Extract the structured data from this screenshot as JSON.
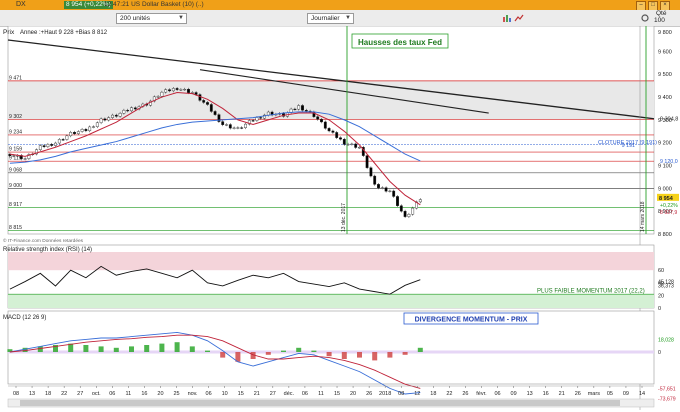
{
  "window": {
    "title": "DX",
    "price_badge": "8 954 (+0,22%)",
    "title_rest": "12:47:21 US Dollar Basket (10) (..)"
  },
  "toolbar": {
    "units_select": "200 unités",
    "period_select": "Journalier",
    "qte_label": "Qté",
    "qte_value": "100"
  },
  "chart_data": [
    {
      "type": "line",
      "panel": "price",
      "title": "Prix",
      "legend": "Annee :+Haut 9 228 +Bias 8 812",
      "source": "© IT-Finance.com Données retardées",
      "ylim": [
        8800,
        9650
      ],
      "y_ticks": [
        8800,
        8900,
        9000,
        9100,
        9200,
        9300,
        9400,
        9500,
        9600,
        9800
      ],
      "left_levels": [
        "9 471",
        "9 302",
        "9 234",
        "9 159",
        "9 119",
        "9 068",
        "9 000",
        "8 917",
        "8 815"
      ],
      "right_labels": [
        "9 304,8",
        "9 191",
        "9 120,0",
        "8 954",
        "+0,22%",
        "8 927,9"
      ],
      "x_ticks": [
        "08",
        "13",
        "18",
        "22",
        "27",
        "oct.",
        "06",
        "11",
        "16",
        "20",
        "25",
        "nov.",
        "06",
        "10",
        "15",
        "21",
        "27",
        "déc.",
        "06",
        "11",
        "15",
        "20",
        "26",
        "2018",
        "08",
        "12",
        "18",
        "22",
        "26",
        "févr.",
        "06",
        "09",
        "13",
        "16",
        "21",
        "26",
        "mars",
        "05",
        "09",
        "14"
      ],
      "annotations": [
        "Hausses des taux Fed",
        "CLOTURE 2017 (9 191)",
        "13 déc. 2017",
        "14 mars 2018"
      ],
      "close_index": [
        0,
        4,
        8,
        12,
        16,
        20,
        24,
        28,
        32,
        36,
        40,
        44,
        48,
        52,
        56,
        60,
        64,
        68,
        72,
        76,
        80,
        84,
        88,
        92,
        96,
        100,
        104,
        108
      ],
      "close": [
        9150,
        9130,
        9180,
        9200,
        9240,
        9255,
        9300,
        9320,
        9350,
        9370,
        9420,
        9440,
        9420,
        9360,
        9280,
        9260,
        9300,
        9330,
        9320,
        9360,
        9320,
        9250,
        9200,
        9180,
        9010,
        8990,
        8870,
        8954
      ],
      "series": [
        {
          "name": "mm20",
          "values": [
            9150,
            9140,
            9160,
            9180,
            9205,
            9230,
            9260,
            9290,
            9330,
            9370,
            9400,
            9420,
            9415,
            9390,
            9350,
            9300,
            9280,
            9300,
            9320,
            9330,
            9330,
            9300,
            9250,
            9190,
            9110,
            9030,
            8970,
            8928
          ]
        },
        {
          "name": "mm50",
          "values": [
            9110,
            9115,
            9125,
            9140,
            9160,
            9175,
            9190,
            9205,
            9225,
            9245,
            9265,
            9280,
            9290,
            9295,
            9300,
            9305,
            9310,
            9320,
            9330,
            9335,
            9335,
            9325,
            9300,
            9270,
            9230,
            9190,
            9150,
            9120
          ]
        }
      ]
    },
    {
      "type": "line",
      "panel": "rsi",
      "title": "Relative strength index (RSI) (14)",
      "ylim": [
        0,
        100
      ],
      "y_ticks": [
        60,
        40,
        20,
        0
      ],
      "right_labels": [
        "45,128",
        "36,373"
      ],
      "annotation": "PLUS FAIBLE MOMENTUM 2017 (22,2)",
      "values": [
        30,
        42,
        55,
        35,
        60,
        48,
        66,
        52,
        58,
        62,
        55,
        48,
        60,
        40,
        35,
        44,
        52,
        48,
        55,
        42,
        38,
        34,
        40,
        30,
        26,
        22,
        36,
        45
      ]
    },
    {
      "type": "bar",
      "panel": "macd",
      "title": "MACD (12 26 9)",
      "banner": "DIVERGENCE MOMENTUM - PRIX",
      "y_ticks": [
        0
      ],
      "right_labels": [
        "18,028",
        "0",
        "-57,651",
        "-73,679"
      ],
      "histogram": [
        4,
        6,
        8,
        10,
        12,
        10,
        8,
        6,
        8,
        10,
        12,
        14,
        8,
        2,
        -8,
        -14,
        -10,
        -4,
        2,
        6,
        2,
        -6,
        -10,
        -8,
        -12,
        -8,
        -4,
        6
      ],
      "macd": [
        0,
        4,
        8,
        12,
        16,
        18,
        20,
        20,
        22,
        24,
        26,
        28,
        24,
        16,
        2,
        -14,
        -20,
        -14,
        -8,
        -2,
        -4,
        -12,
        -20,
        -28,
        -40,
        -52,
        -60,
        -58
      ],
      "signal": [
        0,
        2,
        5,
        8,
        11,
        14,
        16,
        18,
        19,
        21,
        22,
        24,
        24,
        22,
        16,
        6,
        -4,
        -10,
        -10,
        -8,
        -6,
        -8,
        -12,
        -18,
        -26,
        -36,
        -46,
        -52
      ]
    }
  ],
  "colors": {
    "titlebar": "#f0a018",
    "mm20": "#c0243a",
    "mm50": "#3a6fd8",
    "trendline": "#222222",
    "fed_line": "#2aa02a",
    "level_red": "#d62020",
    "level_green": "#1e9a1e",
    "rsi_zone_high": "#f4d4da",
    "rsi_zone_low": "#d4f0d4",
    "macd_zone": "#e6d6f6",
    "candle_up": "#ffffff",
    "candle_down": "#000000"
  }
}
